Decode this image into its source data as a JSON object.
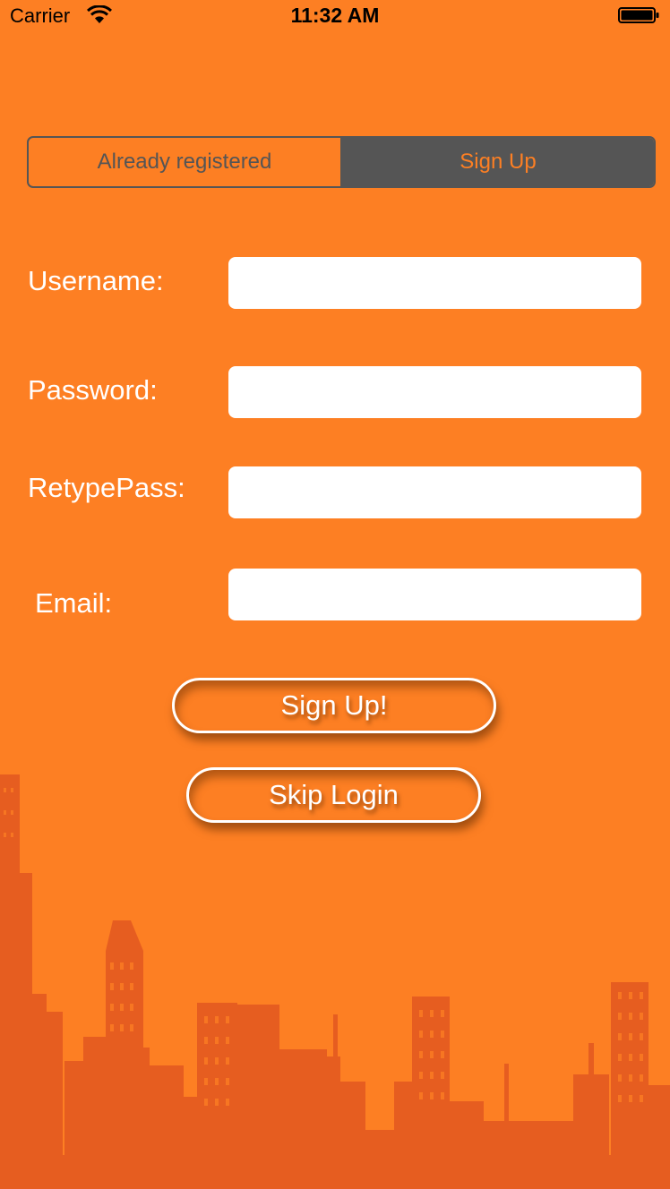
{
  "status_bar": {
    "carrier": "Carrier",
    "time": "11:32 AM"
  },
  "segment": {
    "left_label": "Already registered",
    "right_label": "Sign Up",
    "selected": "Sign Up"
  },
  "form": {
    "username_label": "Username:",
    "password_label": "Password:",
    "retype_label": "RetypePass:",
    "email_label": "Email:",
    "username_value": "",
    "password_value": "",
    "retype_value": "",
    "email_value": ""
  },
  "buttons": {
    "signup_label": "Sign Up!",
    "skip_label": "Skip Login"
  },
  "colors": {
    "background": "#fd7f23",
    "skyline": "#e65d20",
    "segment_dark": "#555555",
    "text": "#ffffff"
  }
}
